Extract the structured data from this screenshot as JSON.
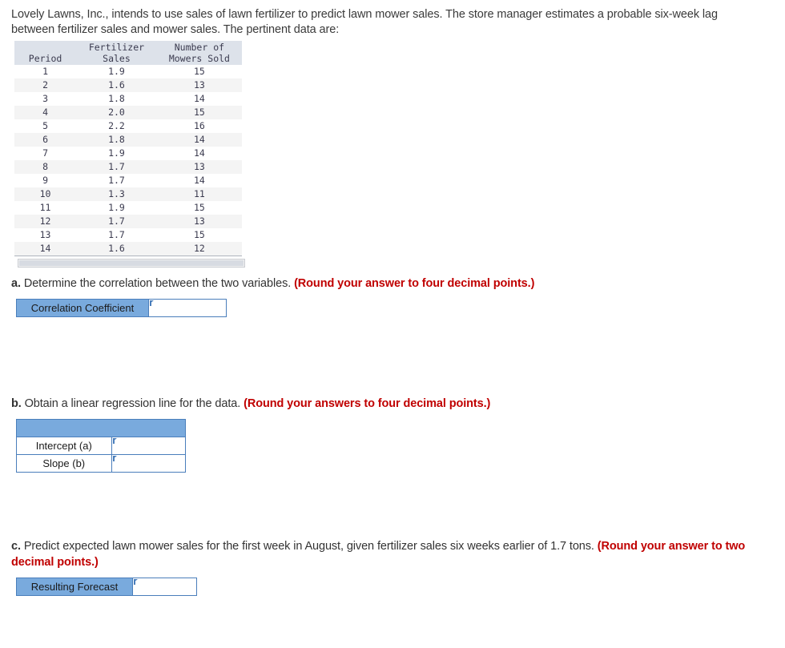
{
  "intro": "Lovely Lawns, Inc., intends to use sales of lawn fertilizer to predict lawn mower sales. The store manager estimates a probable six-week lag between fertilizer sales and mower sales. The pertinent data are:",
  "table": {
    "headers": {
      "period": "Period",
      "fertilizer_line1": "Fertilizer",
      "fertilizer_line2": "Sales",
      "mowers_line1": "Number of",
      "mowers_line2": "Mowers Sold"
    },
    "rows": [
      {
        "period": "1",
        "fertilizer_sales": "1.9",
        "mowers_sold": "15"
      },
      {
        "period": "2",
        "fertilizer_sales": "1.6",
        "mowers_sold": "13"
      },
      {
        "period": "3",
        "fertilizer_sales": "1.8",
        "mowers_sold": "14"
      },
      {
        "period": "4",
        "fertilizer_sales": "2.0",
        "mowers_sold": "15"
      },
      {
        "period": "5",
        "fertilizer_sales": "2.2",
        "mowers_sold": "16"
      },
      {
        "period": "6",
        "fertilizer_sales": "1.8",
        "mowers_sold": "14"
      },
      {
        "period": "7",
        "fertilizer_sales": "1.9",
        "mowers_sold": "14"
      },
      {
        "period": "8",
        "fertilizer_sales": "1.7",
        "mowers_sold": "13"
      },
      {
        "period": "9",
        "fertilizer_sales": "1.7",
        "mowers_sold": "14"
      },
      {
        "period": "10",
        "fertilizer_sales": "1.3",
        "mowers_sold": "11"
      },
      {
        "period": "11",
        "fertilizer_sales": "1.9",
        "mowers_sold": "15"
      },
      {
        "period": "12",
        "fertilizer_sales": "1.7",
        "mowers_sold": "13"
      },
      {
        "period": "13",
        "fertilizer_sales": "1.7",
        "mowers_sold": "15"
      },
      {
        "period": "14",
        "fertilizer_sales": "1.6",
        "mowers_sold": "12"
      }
    ]
  },
  "part_a": {
    "label": "a.",
    "text": " Determine the correlation between the two variables. ",
    "hint": "(Round your answer to four decimal points.)",
    "field_label": "Correlation Coefficient",
    "field_value": "",
    "field_placeholder": ""
  },
  "part_b": {
    "label": "b.",
    "text": " Obtain a linear regression line for the data. ",
    "hint": "(Round your answers to four decimal points.)",
    "header_label": "",
    "intercept_label": "Intercept (a)",
    "intercept_value": "",
    "slope_label": "Slope (b)",
    "slope_value": ""
  },
  "part_c": {
    "label": "c.",
    "text": " Predict expected lawn mower sales for the first week in August, given fertilizer sales six weeks earlier of 1.7 tons. ",
    "hint": "(Round your answer to two decimal points.)",
    "field_label": "Resulting Forecast",
    "field_value": "",
    "field_placeholder": ""
  },
  "colors": {
    "accent_blue": "#79aadd",
    "border_blue": "#4a7ebb",
    "hint_red": "#c00000",
    "table_header_bg": "#dde2ea",
    "stripe": "#f4f4f4"
  }
}
